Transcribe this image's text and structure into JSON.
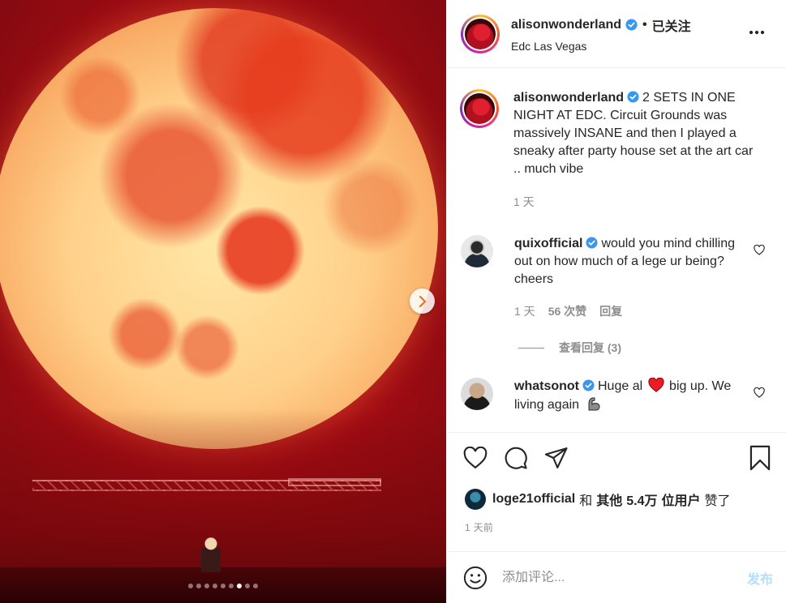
{
  "post": {
    "carousel": {
      "slide_count": 9,
      "active_index": 6
    },
    "icons": {
      "next": "chevron-right-icon"
    }
  },
  "header": {
    "username": "alisonwonderland",
    "separator": "•",
    "follow_label": "已关注",
    "location": "Edc Las Vegas",
    "more_icon": "more-dots-icon"
  },
  "caption": {
    "username": "alisonwonderland",
    "text": "2 SETS IN ONE NIGHT AT EDC. Circuit Grounds was massively INSANE and then I played a sneaky after party house set at the art car .. much vibe",
    "time": "1 天"
  },
  "comments": [
    {
      "username": "quixofficial",
      "verified": true,
      "text": "would you mind chilling out on how much of a lege ur being? cheers",
      "time": "1 天",
      "likes": "56 次赞",
      "reply_label": "回复",
      "view_replies": "查看回复 (3)"
    },
    {
      "username": "whatsonot",
      "verified": true,
      "text_before": "Huge al",
      "text_after": " big up. We living again",
      "emoji": [
        "red-heart-emoji",
        "flexed-biceps-emoji"
      ]
    }
  ],
  "actions": {
    "like_icon": "heart-icon",
    "comment_icon": "comment-icon",
    "share_icon": "send-icon",
    "save_icon": "bookmark-icon"
  },
  "likes": {
    "first_user": "loge21official",
    "and": "和",
    "others": "其他",
    "count": "5.4万",
    "unit": "位用户",
    "suffix": "赞了"
  },
  "date": "1 天前",
  "comment_input": {
    "placeholder": "添加评论...",
    "post_label": "发布",
    "emoji_icon": "smiley-icon"
  },
  "colors": {
    "verified": "#3897f0",
    "muted_text": "#8e8e8e",
    "post_button_disabled": "#b2dffc",
    "heart_emoji": "#ed1c24"
  }
}
